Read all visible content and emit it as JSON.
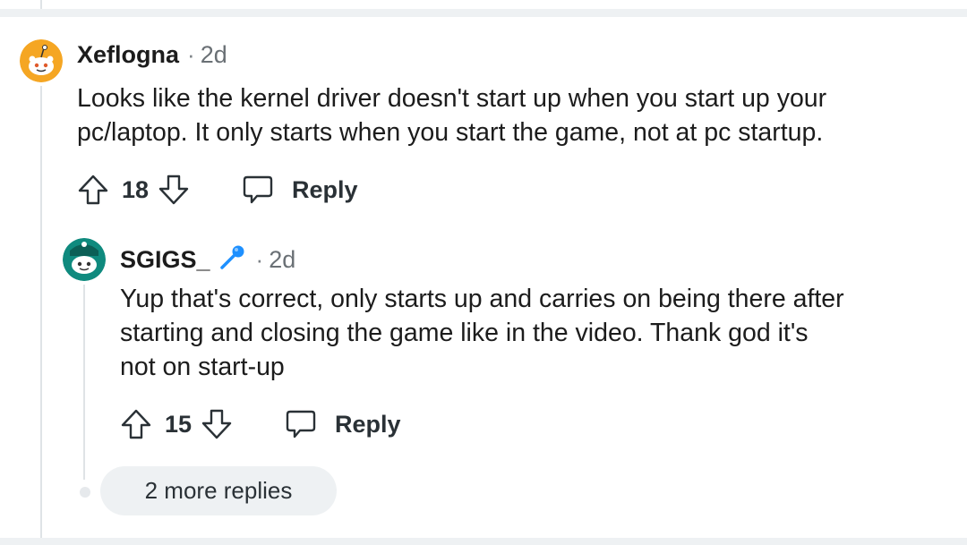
{
  "comments": [
    {
      "username": "Xeflogna",
      "separator": "·",
      "time": "2d",
      "avatar_color": "#f5a623",
      "lines": [
        "Looks like the kernel driver doesn't start up when you start up your",
        "pc/laptop. It only starts when you start the game, not at pc startup."
      ],
      "score": "18",
      "reply_label": "Reply"
    },
    {
      "username": "SGIGS_",
      "separator": "·",
      "time": "2d",
      "avatar_color": "#0f8a7e",
      "flair_icon": "microphone-icon",
      "flair_color": "#1e90ff",
      "lines": [
        "Yup that's correct, only starts up and carries on being there after",
        "starting and closing the game like in the video. Thank god it's",
        "not on start-up"
      ],
      "score": "15",
      "reply_label": "Reply"
    }
  ],
  "more_replies_label": "2 more replies",
  "colors": {
    "thread_line": "#dfe3e6",
    "band": "#eef1f3",
    "text": "#1c1c1c",
    "meta": "#6a7075"
  }
}
